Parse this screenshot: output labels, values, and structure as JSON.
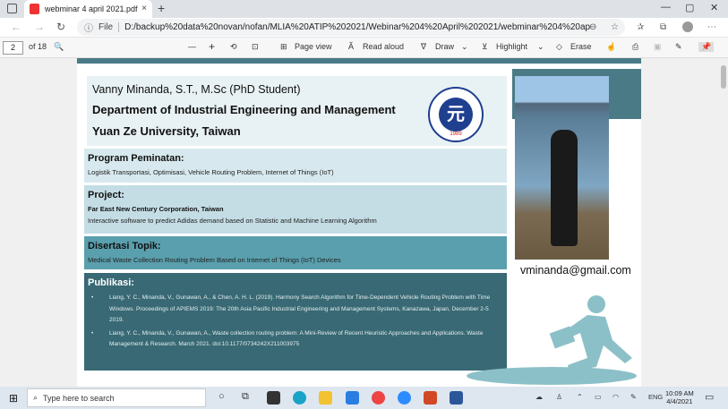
{
  "browser": {
    "tab_title": "webminar 4 april 2021.pdf",
    "new_tab": "+",
    "tab_close": "×",
    "win_min": "—",
    "win_max": "▢",
    "win_close": "✕",
    "back": "←",
    "forward": "→",
    "refresh": "↻",
    "info": "ⓘ",
    "file_label": "File",
    "url": "D:/backup%20data%20novan/nofan/MLIA%20ATIP%202021/Webinar%204%20April%202021/webminar%204%20april%...",
    "menu": "⋯"
  },
  "pdf_toolbar": {
    "page_current": "2",
    "page_total": "of 18",
    "search": "🔍",
    "zoom_out": "—",
    "zoom_in": "+",
    "rotate": "⟲",
    "fit": "⊡",
    "page_view": "Page view",
    "read_aloud": "Read aloud",
    "draw": "Draw",
    "highlight": "Highlight",
    "erase": "Erase"
  },
  "poster": {
    "name": "Vanny Minanda, S.T., M.Sc (PhD Student)",
    "department": "Department of Industrial Engineering and Management",
    "university": "Yuan Ze University, Taiwan",
    "logo_year": "1989",
    "program_title": "Program Peminatan:",
    "program_text": "Logistik Transportasi, Optimisasi, Vehicle Routing Problem, Internet of Things (IoT)",
    "project_title": "Project:",
    "project_company": "Far East New Century Corporation, Taiwan",
    "project_text": "Interactive software to predict Adidas demand based on Statistic and Machine Learning Algorithm",
    "dissertation_title": "Disertasi Topik:",
    "dissertation_text": "Medical Waste Collection Routing Problem Based on Internet of Things (IoT) Devices",
    "publications_title": "Publikasi:",
    "publications": [
      "Liang, Y. C., Minanda, V., Gunawan, A., & Chen, A. H. L. (2019). Harmony Search Algorithm for Time-Dependent Vehicle Routing Problem with Time Windows. Proceedings of APIEMS 2019: The 20th Asia Pacific Industrial Engineering and Management Systems, Kanazawa, Japan, December 2-5 2019.",
      "Liang, Y. C., Minanda, V., Gunawan, A., Waste collection routing problem: A Mini-Review of Recent Heuristic Approaches and Applications. Waste Management & Research. March 2021. doi:10.1177/0734242X211003975"
    ],
    "email": "vminanda@gmail.com"
  },
  "taskbar": {
    "search_placeholder": "Type here to search",
    "lang": "ENG",
    "time": "10:09 AM",
    "date": "4/4/2021"
  },
  "colors": {
    "accent": "#386974",
    "teal": "#5a9fad",
    "light": "#d7e9ee"
  }
}
